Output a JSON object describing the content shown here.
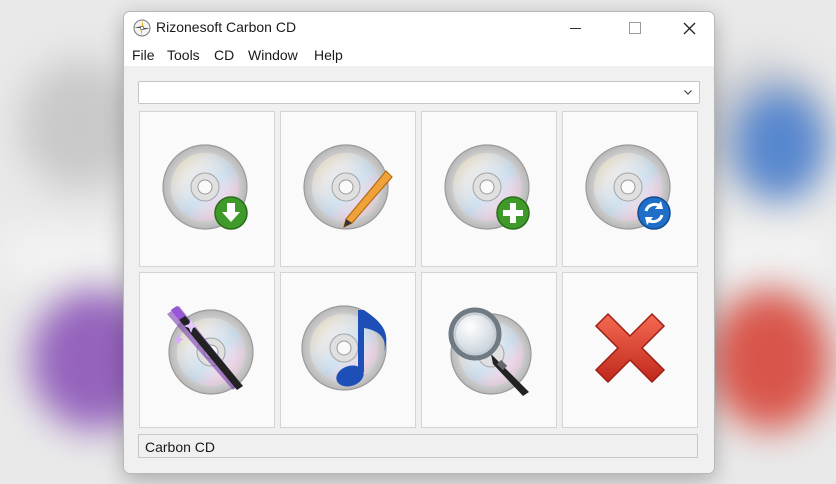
{
  "window": {
    "title": "Rizonesoft Carbon CD",
    "controls": [
      "minimize-icon",
      "maximize-icon",
      "close-icon"
    ]
  },
  "menu": {
    "items": [
      {
        "label": "File"
      },
      {
        "label": "Tools"
      },
      {
        "label": "CD"
      },
      {
        "label": "Window"
      },
      {
        "label": "Help"
      }
    ]
  },
  "drive_selector": {
    "value": ""
  },
  "actions": [
    {
      "icon": "cd-download-icon",
      "badge_color": "#3f9a2a"
    },
    {
      "icon": "cd-edit-icon",
      "badge_color": "#e58a1f"
    },
    {
      "icon": "cd-add-icon",
      "badge_color": "#3f9a2a"
    },
    {
      "icon": "cd-refresh-icon",
      "badge_color": "#1f6fc9"
    },
    {
      "icon": "cd-magic-wand-icon",
      "badge_color": "#7a3cb0"
    },
    {
      "icon": "cd-music-note-icon",
      "badge_color": "#1d4fb6"
    },
    {
      "icon": "cd-magnifier-icon",
      "badge_color": "#9aa3ab"
    },
    {
      "icon": "red-x-icon",
      "badge_color": "#d9372a"
    }
  ],
  "status_bar": {
    "text": "Carbon CD"
  }
}
